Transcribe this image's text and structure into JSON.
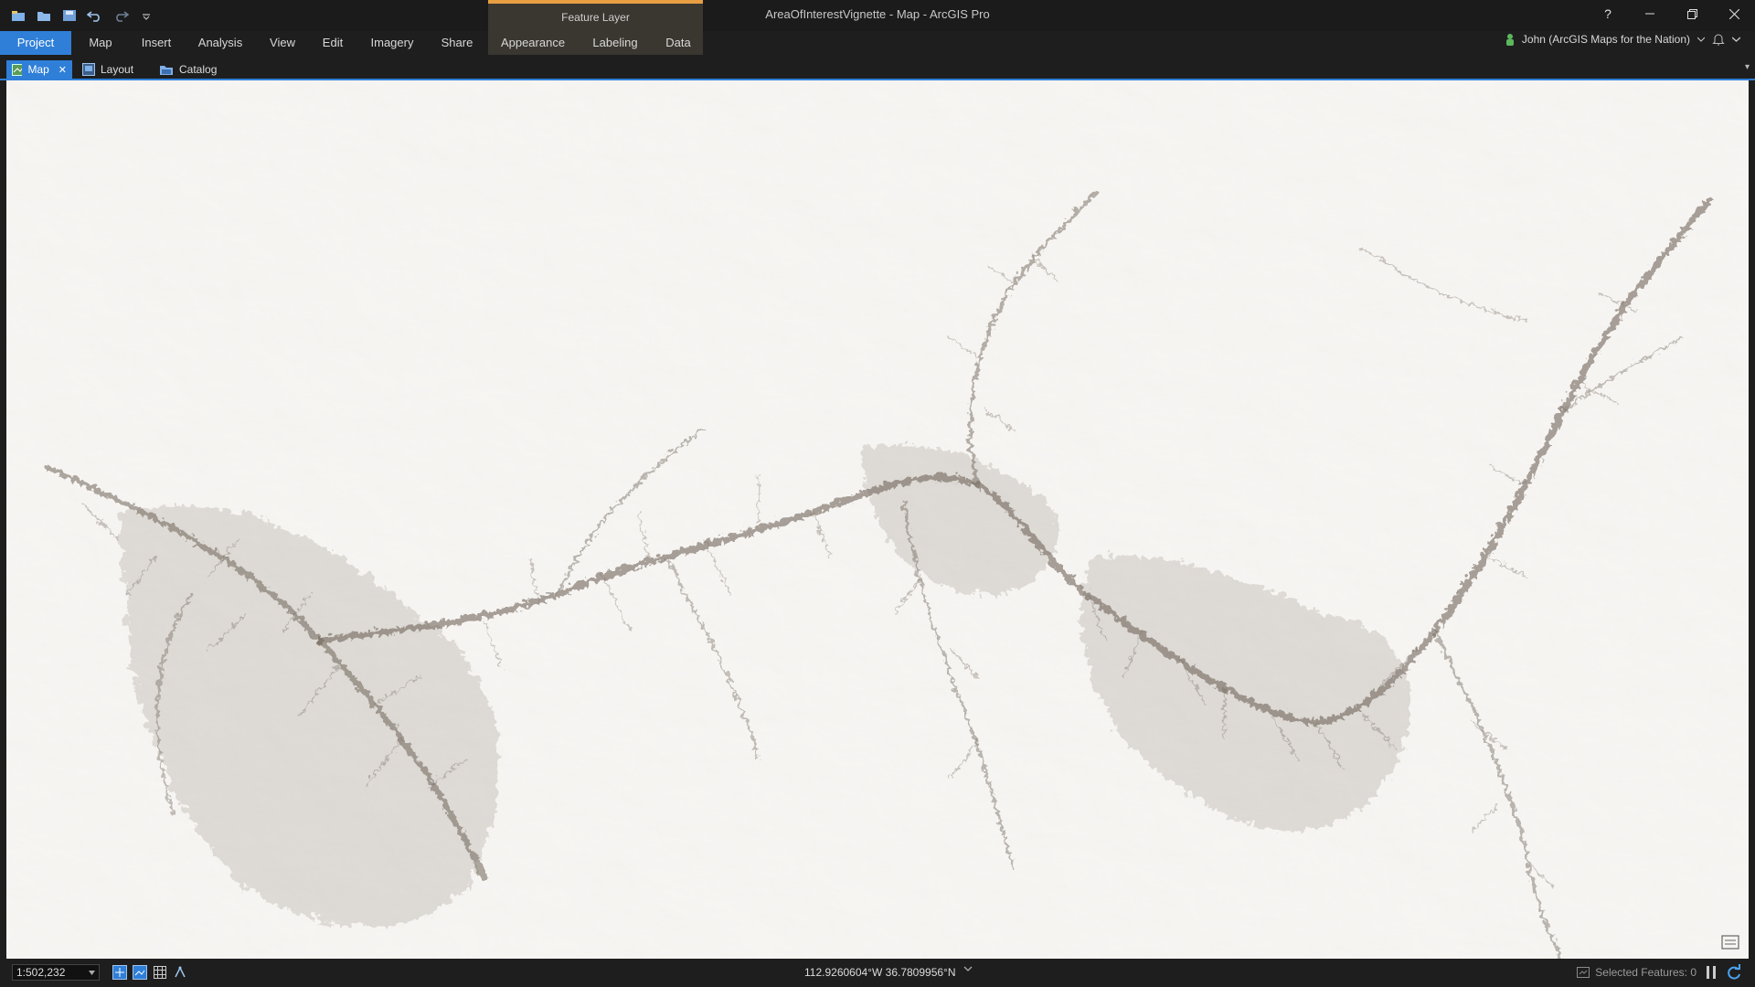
{
  "window": {
    "title": "AreaOfInterestVignette - Map - ArcGIS Pro",
    "context_group": "Feature Layer",
    "help": "?"
  },
  "ribbon": {
    "tabs": [
      {
        "label": "Project"
      },
      {
        "label": "Map"
      },
      {
        "label": "Insert"
      },
      {
        "label": "Analysis"
      },
      {
        "label": "View"
      },
      {
        "label": "Edit"
      },
      {
        "label": "Imagery"
      },
      {
        "label": "Share"
      },
      {
        "label": "Appearance"
      },
      {
        "label": "Labeling"
      },
      {
        "label": "Data"
      }
    ],
    "active_tab": "Project"
  },
  "user": {
    "name": "John (ArcGIS Maps for the Nation)"
  },
  "doc_tabs": [
    {
      "label": "Map"
    },
    {
      "label": "Layout"
    },
    {
      "label": "Catalog"
    }
  ],
  "status": {
    "scale": "1:502,232",
    "coordinates": "112.9260604°W 36.7809956°N",
    "selected_features": "Selected Features: 0"
  },
  "colors": {
    "accent": "#2f7fd8",
    "context_accent": "#e89f44",
    "map_background": "#f4f2ef",
    "terrain": "#6f655a"
  }
}
